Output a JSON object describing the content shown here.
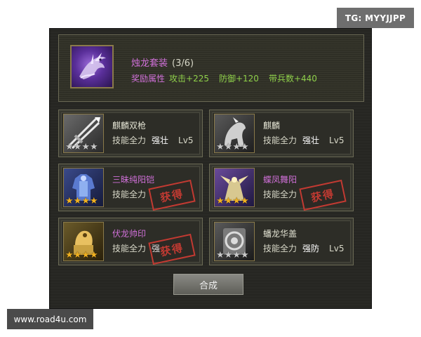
{
  "watermark_top": "TG: MYYJJPP",
  "watermark_bottom": "www.road4u.com",
  "set": {
    "icon": "dragon-icon",
    "title": "烛龙套装",
    "count": "(3/6)",
    "bonus_label": "奖励属性",
    "bonus_values": [
      "攻击+225",
      "防御+120",
      "带兵数+440"
    ]
  },
  "items": [
    {
      "name": "麒麟双枪",
      "name_color": "#e0e0d0",
      "skill_label": "技能全力",
      "skill": "强壮",
      "level": "Lv5",
      "stars": 4,
      "star_color": "silver",
      "icon": "spear-icon",
      "obtained": false
    },
    {
      "name": "麒麟",
      "name_color": "#e0e0d0",
      "skill_label": "技能全力",
      "skill": "强壮",
      "level": "Lv5",
      "stars": 4,
      "star_color": "silver",
      "icon": "qilin-mount-icon",
      "obtained": false
    },
    {
      "name": "三昧纯阳铠",
      "name_color": "#d070d8",
      "skill_label": "技能全力",
      "skill": "",
      "level": "",
      "stars": 4,
      "star_color": "gold",
      "icon": "armor-icon",
      "obtained": true,
      "stamp": "获得"
    },
    {
      "name": "蝶凤舞阳",
      "name_color": "#d070d8",
      "skill_label": "技能全力",
      "skill": "",
      "level": "",
      "stars": 4,
      "star_color": "gold",
      "icon": "phoenix-mount-icon",
      "obtained": true,
      "stamp": "获得"
    },
    {
      "name": "伏龙帅印",
      "name_color": "#d070d8",
      "skill_label": "技能全力",
      "skill": "强",
      "level": "",
      "stars": 4,
      "star_color": "gold",
      "icon": "seal-icon",
      "obtained": true,
      "stamp": "获得"
    },
    {
      "name": "蟠龙华盖",
      "name_color": "#e0e0d0",
      "skill_label": "技能全力",
      "skill": "强防",
      "level": "Lv5",
      "stars": 4,
      "star_color": "silver",
      "icon": "canopy-icon",
      "obtained": false
    }
  ],
  "combine_button": "合成"
}
